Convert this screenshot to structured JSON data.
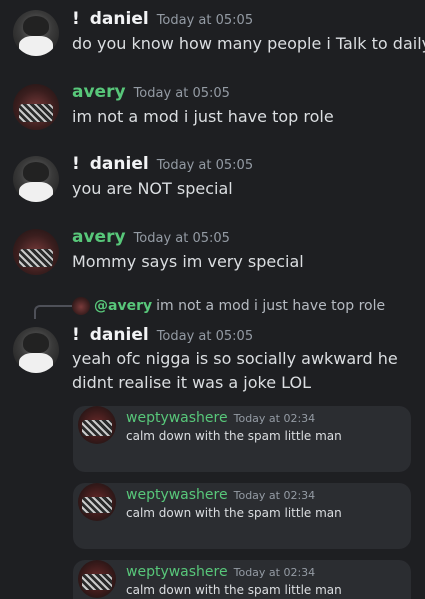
{
  "messages": [
    {
      "bang": "!",
      "author": "daniel",
      "time": "Today at 05:05",
      "lines": [
        "do you know how many people i Talk to daily"
      ]
    },
    {
      "author": "avery",
      "time": "Today at 05:05",
      "lines": [
        "im not a mod i just have top role"
      ]
    },
    {
      "bang": "!",
      "author": "daniel",
      "time": "Today at 05:05",
      "lines": [
        "you are NOT special"
      ]
    },
    {
      "author": "avery",
      "time": "Today at 05:05",
      "lines": [
        "Mommy says im very special"
      ]
    },
    {
      "bang": "!",
      "author": "daniel",
      "time": "Today at 05:05",
      "lines": [
        "yeah ofc nigga is so socially awkward he",
        "didnt realise it was a joke LOL"
      ],
      "reply": {
        "name": "@avery",
        "text": "im not a mod i just have top role"
      }
    }
  ],
  "embeds": [
    {
      "author": "weptywashere",
      "time": "Today at 02:34",
      "text": "calm down with the spam little man"
    },
    {
      "author": "weptywashere",
      "time": "Today at 02:34",
      "text": "calm down with the spam little man"
    },
    {
      "author": "weptywashere",
      "time": "Today at 02:34",
      "text": "calm down with the spam little man"
    }
  ],
  "colors": {
    "background": "#1e1f22",
    "username_green": "#58c77a",
    "username_white": "#f2f3f5",
    "timestamp": "#949ba4",
    "embed_bg": "#2b2d31"
  }
}
